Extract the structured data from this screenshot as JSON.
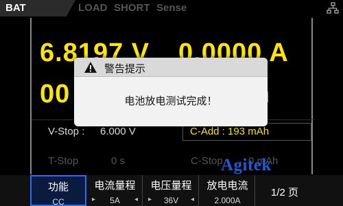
{
  "topbar": {
    "modes": [
      "BAT",
      "LOAD",
      "SHORT",
      "Sense"
    ],
    "active_mode": "BAT"
  },
  "readings": {
    "voltage": "6.8197 V",
    "current": "0.0000 A",
    "partial_left": "00",
    "partial_right": "h"
  },
  "params": {
    "vstop_label": "V-Stop :",
    "vstop_value": "6.000 V",
    "cadd_label": "C-Add :",
    "cadd_value": "193 mAh",
    "tstop_label": "T-Stop",
    "tstop_value": "0 s",
    "cstop_label": "C-Stop",
    "cstop_value": "0 mAh"
  },
  "softkeys": [
    {
      "label": "功能",
      "value": "CC"
    },
    {
      "label": "电流量程",
      "value": "5A"
    },
    {
      "label": "电压量程",
      "value": "36V"
    },
    {
      "label": "放电电流",
      "value": "2.000A"
    },
    {
      "label": "1/2 页",
      "value": ""
    }
  ],
  "dialog": {
    "title": "警告提示",
    "message": "电池放电测试完成！"
  },
  "watermark": "Agitek",
  "colors": {
    "reading": "#ffe600",
    "function_border": "#2a6cff",
    "watermark": "#1e5bd6"
  },
  "icons": {
    "network": "network-icon",
    "warning": "warning-icon"
  }
}
